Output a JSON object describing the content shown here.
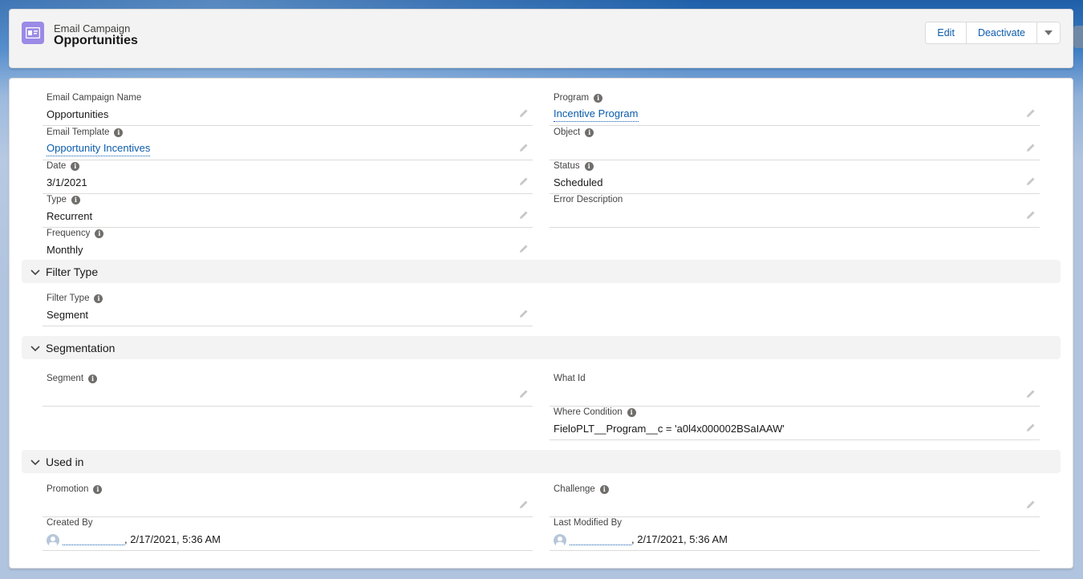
{
  "header": {
    "object_type": "Email Campaign",
    "record_name": "Opportunities",
    "buttons": {
      "edit": "Edit",
      "deactivate": "Deactivate"
    }
  },
  "fields": {
    "email_campaign_name": {
      "label": "Email Campaign Name",
      "value": "Opportunities"
    },
    "program": {
      "label": "Program",
      "value": "Incentive Program"
    },
    "email_template": {
      "label": "Email Template",
      "value": "Opportunity Incentives"
    },
    "object": {
      "label": "Object",
      "value": ""
    },
    "date": {
      "label": "Date",
      "value": "3/1/2021"
    },
    "status": {
      "label": "Status",
      "value": "Scheduled"
    },
    "type": {
      "label": "Type",
      "value": "Recurrent"
    },
    "error_description": {
      "label": "Error Description",
      "value": ""
    },
    "frequency": {
      "label": "Frequency",
      "value": "Monthly"
    },
    "filter_type": {
      "label": "Filter Type",
      "value": "Segment"
    },
    "segment": {
      "label": "Segment",
      "value": ""
    },
    "what_id": {
      "label": "What Id",
      "value": ""
    },
    "where_condition": {
      "label": "Where Condition",
      "value": "FieloPLT__Program__c = 'a0l4x000002BSaIAAW'"
    },
    "promotion": {
      "label": "Promotion",
      "value": ""
    },
    "challenge": {
      "label": "Challenge",
      "value": ""
    },
    "created_by": {
      "label": "Created By",
      "value": ", 2/17/2021, 5:36 AM"
    },
    "last_modified_by": {
      "label": "Last Modified By",
      "value": ", 2/17/2021, 5:36 AM"
    }
  },
  "sections": {
    "filter_type": "Filter Type",
    "segmentation": "Segmentation",
    "used_in": "Used in"
  },
  "colors": {
    "link": "#0b5cab",
    "object_icon": "#9b8ae6",
    "section_bg": "#f3f3f3"
  }
}
